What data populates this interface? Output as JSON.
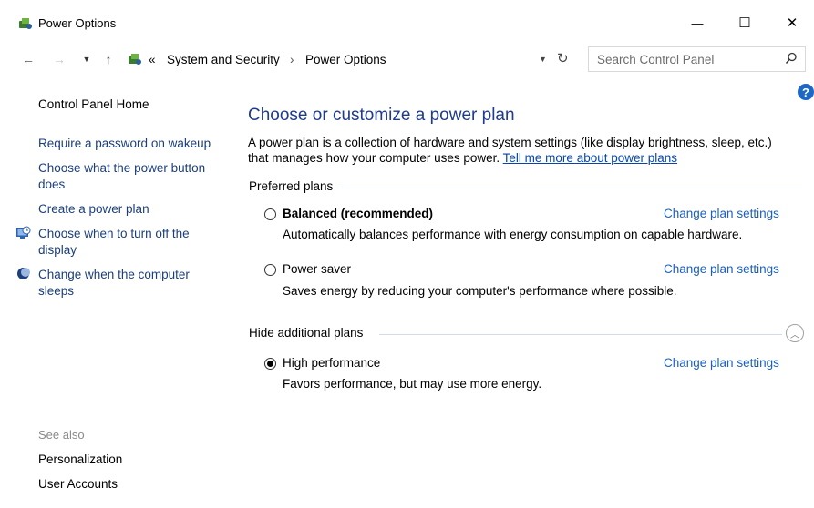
{
  "window": {
    "title": "Power Options",
    "minimize": "—",
    "maximize": "☐",
    "close": "✕"
  },
  "address": {
    "overflow": "«",
    "crumb1": "System and Security",
    "separator": "›",
    "crumb2": "Power Options",
    "search_placeholder": "Search Control Panel"
  },
  "left": {
    "home": "Control Panel Home",
    "links": [
      "Require a password on wakeup",
      "Choose what the power button does",
      "Create a power plan",
      "Choose when to turn off the display",
      "Change when the computer sleeps"
    ],
    "see_also": "See also",
    "see_also_links": [
      "Personalization",
      "User Accounts"
    ]
  },
  "main": {
    "heading": "Choose or customize a power plan",
    "description": "A power plan is a collection of hardware and system settings (like display brightness, sleep, etc.) that manages how your computer uses power.",
    "learn_more": "Tell me more about power plans",
    "preferred_label": "Preferred plans",
    "additional_label": "Hide additional plans",
    "change_label": "Change plan settings",
    "plans": [
      {
        "name": "Balanced (recommended)",
        "desc": "Automatically balances performance with energy consumption on capable hardware.",
        "selected": false
      },
      {
        "name": "Power saver",
        "desc": "Saves energy by reducing your computer's performance where possible.",
        "selected": false
      },
      {
        "name": "High performance",
        "desc": "Favors performance, but may use more energy.",
        "selected": true
      }
    ]
  },
  "help": "?"
}
